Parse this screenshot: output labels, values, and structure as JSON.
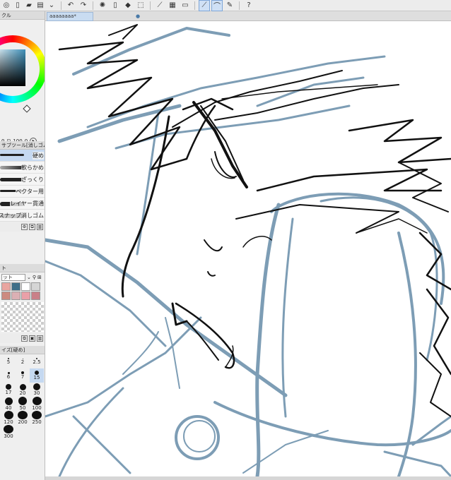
{
  "toolbar": {
    "icons": [
      "settings-icon",
      "new-icon",
      "open-icon",
      "save-icon",
      "undo-icon",
      "redo-icon",
      "spinner-icon",
      "fill-icon",
      "transform-icon",
      "pen-icon",
      "help-icon"
    ]
  },
  "left_panel": {
    "color_panel_title": "クル",
    "hsv": {
      "value_a": "0",
      "value_b": "100",
      "value_c": "0"
    },
    "subtool": {
      "title": "サブツール[消しゴム]",
      "items": [
        {
          "label": "硬め"
        },
        {
          "label": "軟らかめ"
        },
        {
          "label": "ざっくり"
        },
        {
          "label": "ベクター用"
        },
        {
          "label": "レイヤー貫通"
        },
        {
          "label": "スナップ消しゴム"
        }
      ]
    },
    "color_set": {
      "title": "ト",
      "selected": "ット",
      "swatches": [
        "#e9a5a0",
        "#3e6f88",
        "#ffffff",
        "#d5d5d5",
        "#cc8a80",
        "#dbb0b4",
        "#e9a0a8",
        "#c98088"
      ]
    },
    "brush_size": {
      "title": "イズ[硬め]",
      "sizes": [
        "5",
        "2",
        "2.5",
        "6",
        "7",
        "15",
        "17",
        "20",
        "30",
        "40",
        "50",
        "100",
        "120",
        "200",
        "250",
        "300"
      ]
    }
  },
  "canvas": {
    "tab_title": "aaaaaaaa*"
  },
  "colors": {
    "sketch_blue": "#6f93ad",
    "ink": "#111111",
    "accent": "#3d8fb8"
  }
}
